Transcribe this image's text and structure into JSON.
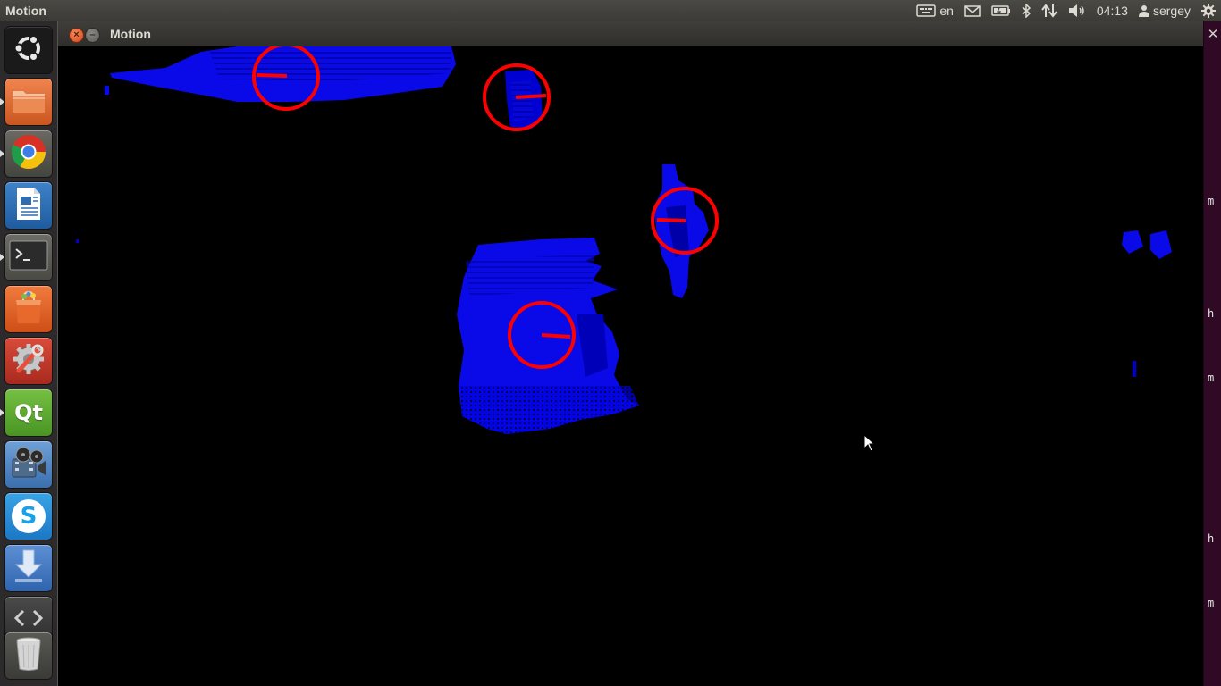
{
  "top_panel": {
    "app_title": "Motion",
    "keyboard_layout": "en",
    "clock": "04:13",
    "user_name": "sergey",
    "icons": [
      "keyboard-icon",
      "mail-icon",
      "battery-icon",
      "bluetooth-icon",
      "network-icon",
      "volume-icon",
      "user-icon",
      "session-gear-icon"
    ]
  },
  "launcher": {
    "items": [
      {
        "name": "dash-home",
        "running": false
      },
      {
        "name": "files",
        "running": true
      },
      {
        "name": "chrome",
        "running": true
      },
      {
        "name": "libreoffice-writer",
        "running": false
      },
      {
        "name": "terminal",
        "running": true
      },
      {
        "name": "software-center",
        "running": false
      },
      {
        "name": "system-settings",
        "running": false
      },
      {
        "name": "qt-creator",
        "running": true
      },
      {
        "name": "video-app",
        "running": false
      },
      {
        "name": "skype",
        "running": false
      },
      {
        "name": "update-manager",
        "running": false
      },
      {
        "name": "workspace-switcher",
        "running": false
      },
      {
        "name": "trash",
        "running": false
      }
    ],
    "qt_label": "Qt",
    "skype_label": "S"
  },
  "window": {
    "title": "Motion",
    "close_symbol": "×",
    "minimize_symbol": "–"
  },
  "scene": {
    "point_cloud_color": "#0000ff",
    "marker_color": "#ff0000",
    "background": "#000000"
  },
  "background_terminal": {
    "close_symbol": "✕",
    "chars": [
      "m",
      "h",
      "m",
      "h",
      "m"
    ]
  }
}
